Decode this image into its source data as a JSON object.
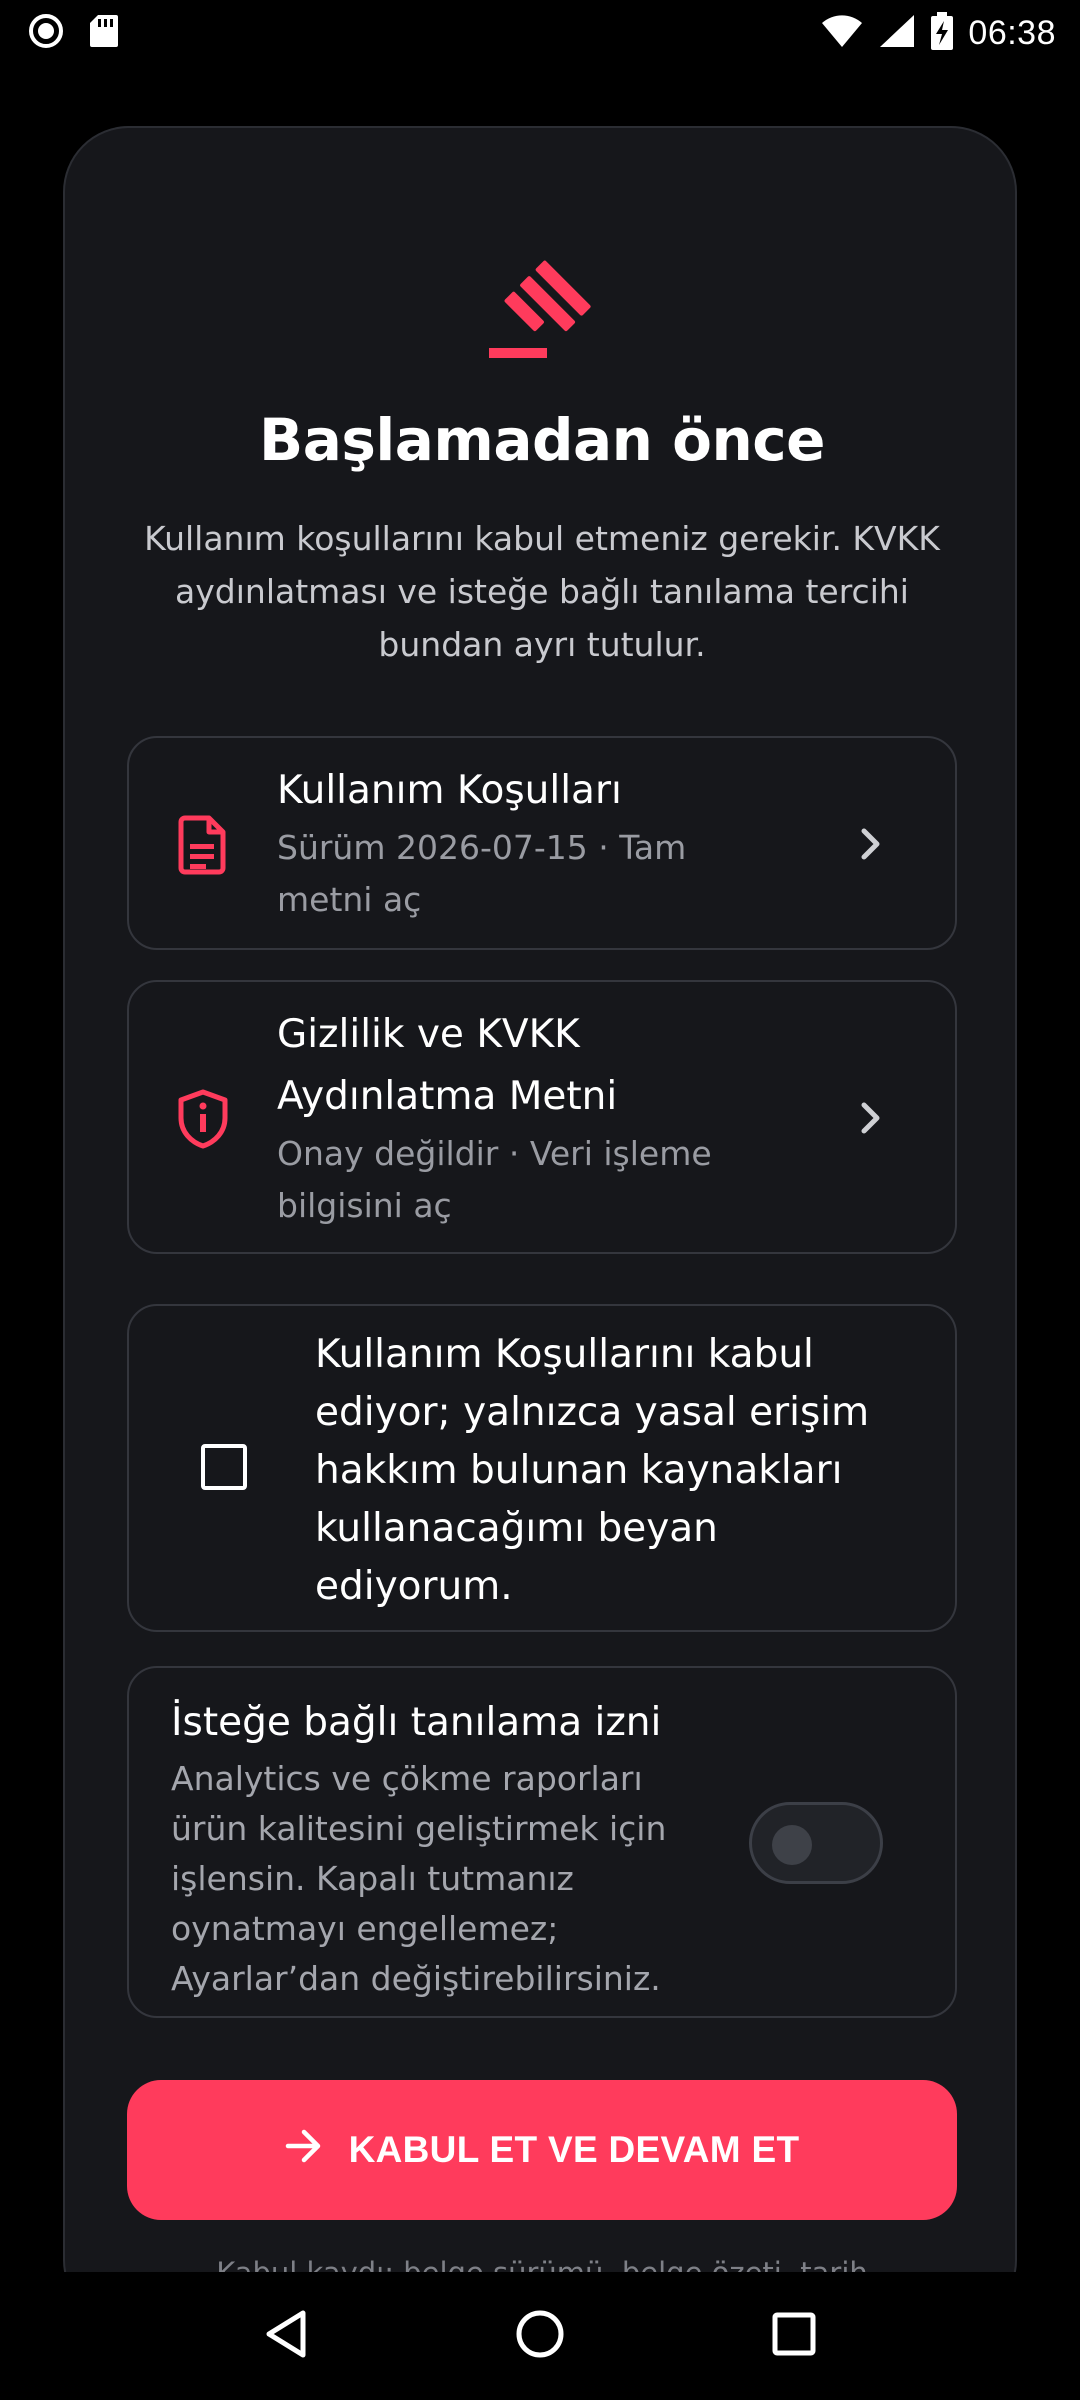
{
  "status_bar": {
    "time": "06:38",
    "icons": [
      "record-icon",
      "sd-card-icon",
      "wifi-icon",
      "cellular-signal-icon",
      "battery-charging-icon"
    ]
  },
  "header": {
    "title": "Başlamadan önce",
    "subtitle": "Kullanım koşullarını kabul etmeniz gerekir. KVKK aydınlatması ve isteğe bağlı tanılama tercihi bundan ayrı tutulur."
  },
  "documents": [
    {
      "title": "Kullanım Koşulları",
      "subtitle": "Sürüm 2026-07-15 · Tam metni aç",
      "icon": "document-icon"
    },
    {
      "title": "Gizlilik ve KVKK Aydınlatma Metni",
      "subtitle": "Onay değildir · Veri işleme bilgisini aç",
      "icon": "shield-info-icon"
    }
  ],
  "consent": {
    "checked": false,
    "label": "Kullanım Koşullarını kabul ediyor; yalnızca yasal erişim hakkım bulunan kaynakları kullanacağımı beyan ediyorum."
  },
  "diagnostics": {
    "title": "İsteğe bağlı tanılama izni",
    "description": "Analytics ve çökme raporları ürün kalitesini geliştirmek için işlensin. Kapalı tutmanız oynatmayı engellemez; Ayarlar’dan değiştirebilirsiniz.",
    "enabled": false
  },
  "primary_button": {
    "label": "KABUL ET VE DEVAM ET",
    "icon": "arrow-right-icon"
  },
  "footnote": "Kabul kaydı; belge sürümü, belge özeti, tarih ve dil bilgisiyle bu cihazda saklanır.",
  "colors": {
    "accent": "#ff3b5c",
    "background": "#000000",
    "card": "#16171b",
    "border": "#34363d"
  },
  "nav_bar": {
    "icons": [
      "back-icon",
      "home-icon",
      "recents-icon"
    ]
  }
}
